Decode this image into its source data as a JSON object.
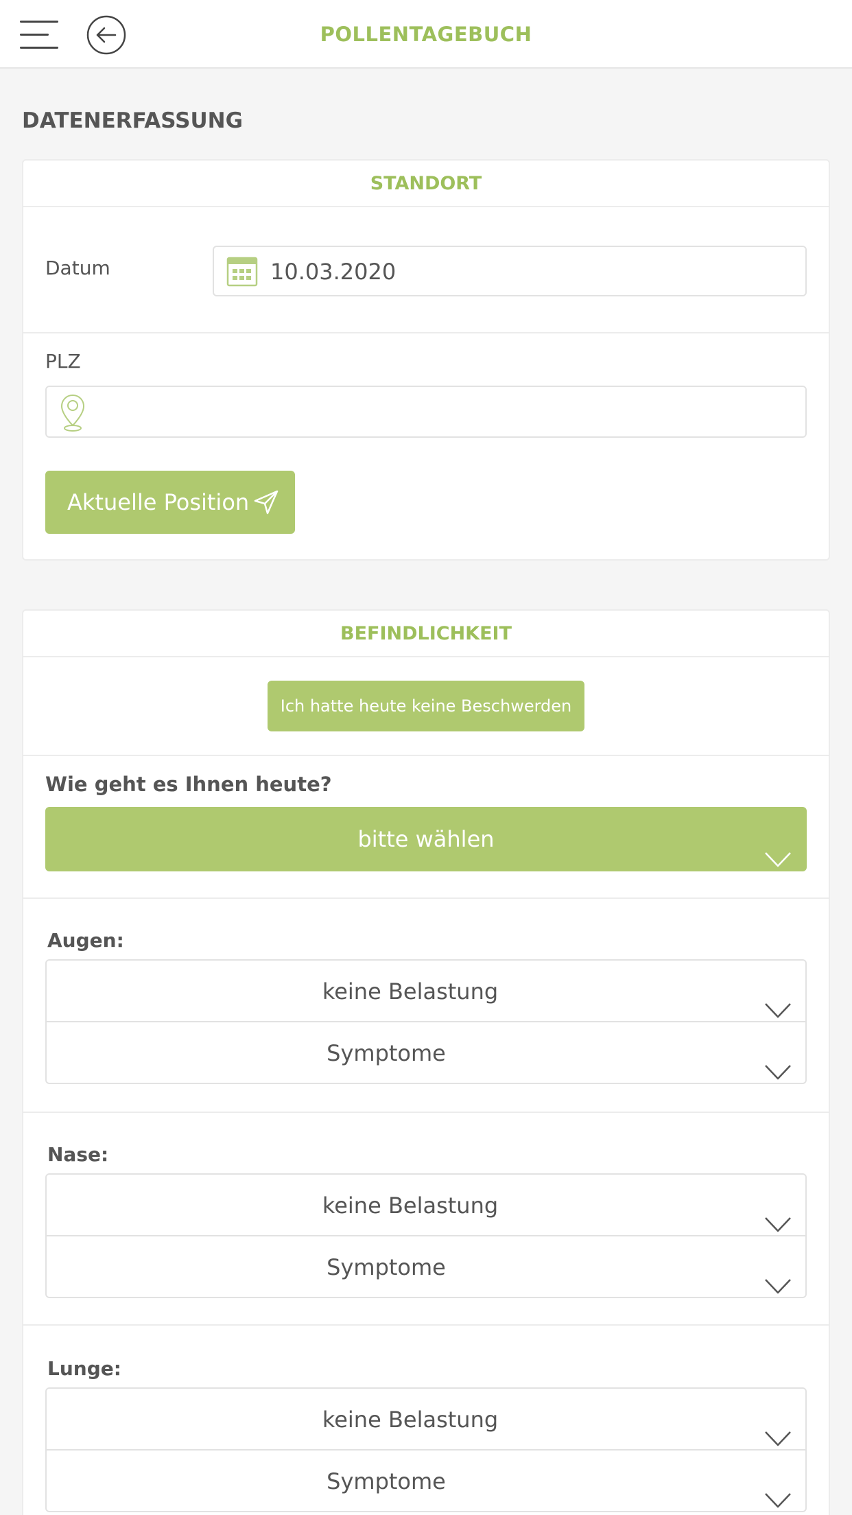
{
  "header": {
    "title": "POLLENTAGEBUCH"
  },
  "page": {
    "heading": "DATENERFASSUNG"
  },
  "standort": {
    "title": "STANDORT",
    "date_label": "Datum",
    "date_value": "10.03.2020",
    "plz_label": "PLZ",
    "plz_value": "",
    "position_button": "Aktuelle Position"
  },
  "befindlichkeit": {
    "title": "BEFINDLICHKEIT",
    "no_complaints_button": "Ich hatte heute keine Beschwerden",
    "question": "Wie geht es Ihnen heute?",
    "mood_select": "bitte wählen",
    "sections": [
      {
        "label": "Augen:",
        "severity": "keine Belastung",
        "symptoms": "Symptome"
      },
      {
        "label": "Nase:",
        "severity": "keine Belastung",
        "symptoms": "Symptome"
      },
      {
        "label": "Lunge:",
        "severity": "keine Belastung",
        "symptoms": "Symptome"
      }
    ]
  },
  "colors": {
    "accent": "#9dbf5b",
    "button": "#afc96f",
    "text": "#555555"
  },
  "icons": [
    "menu-icon",
    "back-arrow-icon",
    "calendar-icon",
    "location-pin-icon",
    "send-icon",
    "chevron-down-icon"
  ]
}
